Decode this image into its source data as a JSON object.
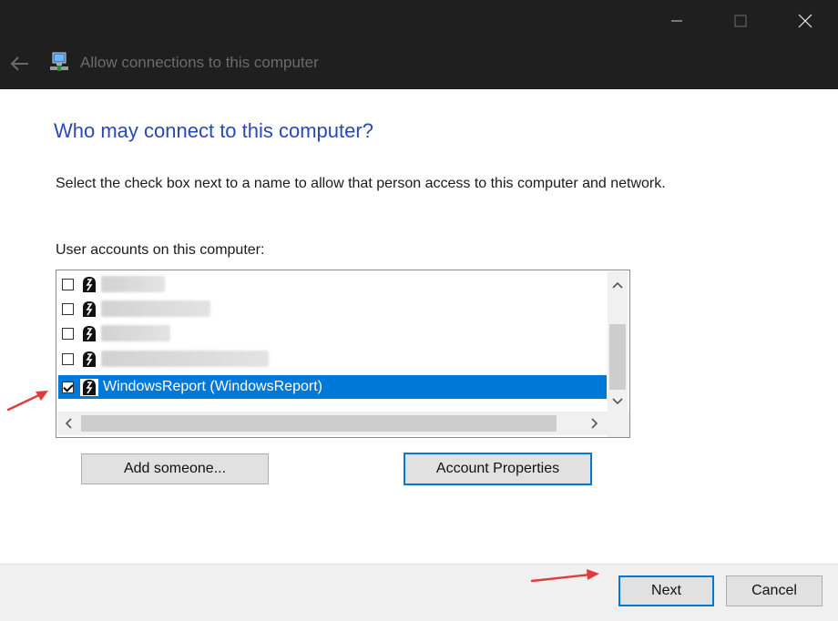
{
  "window": {
    "title": "Allow connections to this computer",
    "controls": {
      "minimize": "minimize-icon",
      "maximize": "maximize-icon",
      "close": "close-icon"
    },
    "back_icon": "back-arrow-icon",
    "app_icon": "network-computer-icon"
  },
  "page": {
    "heading": "Who may connect to this computer?",
    "description": "Select the check box next to a name to allow that person access to this computer and network.",
    "list_label": "User accounts on this computer:"
  },
  "accounts": [
    {
      "name": "",
      "checked": false,
      "redacted": true
    },
    {
      "name": "",
      "checked": false,
      "redacted": true
    },
    {
      "name": "",
      "checked": false,
      "redacted": true
    },
    {
      "name": "",
      "checked": false,
      "redacted": true
    },
    {
      "name": "WindowsReport (WindowsReport)",
      "checked": true,
      "selected": true
    }
  ],
  "buttons": {
    "add_someone": "Add someone...",
    "account_properties": "Account Properties",
    "next": "Next",
    "cancel": "Cancel"
  },
  "colors": {
    "heading": "#2a49b5",
    "selection": "#0078d7",
    "annotation_arrow": "#e03c3c",
    "titlebar": "#1f1f1f"
  }
}
